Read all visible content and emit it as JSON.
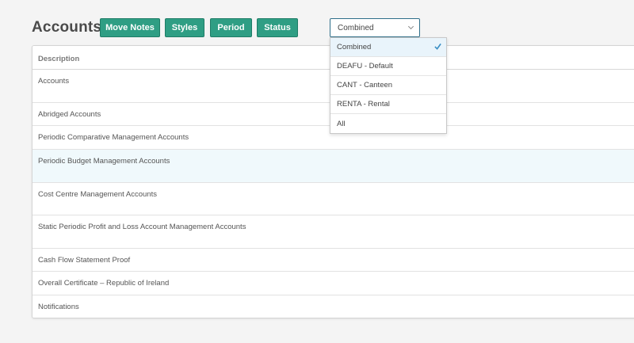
{
  "header": {
    "title": "Accounts",
    "buttons": [
      {
        "label": "Move Notes"
      },
      {
        "label": "Styles"
      },
      {
        "label": "Period"
      },
      {
        "label": "Status"
      }
    ]
  },
  "filter": {
    "selected": "Combined",
    "options": [
      {
        "label": "Combined",
        "selected": true
      },
      {
        "label": "DEAFU - Default",
        "selected": false
      },
      {
        "label": "CANT - Canteen",
        "selected": false
      },
      {
        "label": "RENTA - Rental",
        "selected": false
      },
      {
        "label": "All",
        "selected": false
      }
    ]
  },
  "table": {
    "column_header": "Description",
    "rows": [
      {
        "label": "Accounts"
      },
      {
        "label": "Abridged Accounts"
      },
      {
        "label": "Periodic Comparative Management Accounts"
      },
      {
        "label": "Periodic Budget Management Accounts"
      },
      {
        "label": "Cost Centre Management Accounts"
      },
      {
        "label": "Static Periodic Profit and Loss Account Management Accounts"
      },
      {
        "label": "Cash Flow Statement Proof"
      },
      {
        "label": "Overall Certificate – Republic of Ireland"
      },
      {
        "label": "Notifications"
      }
    ]
  },
  "colors": {
    "button_bg": "#2f9e84",
    "highlight_row": "#f0f9fc",
    "check": "#3a8fc4"
  }
}
